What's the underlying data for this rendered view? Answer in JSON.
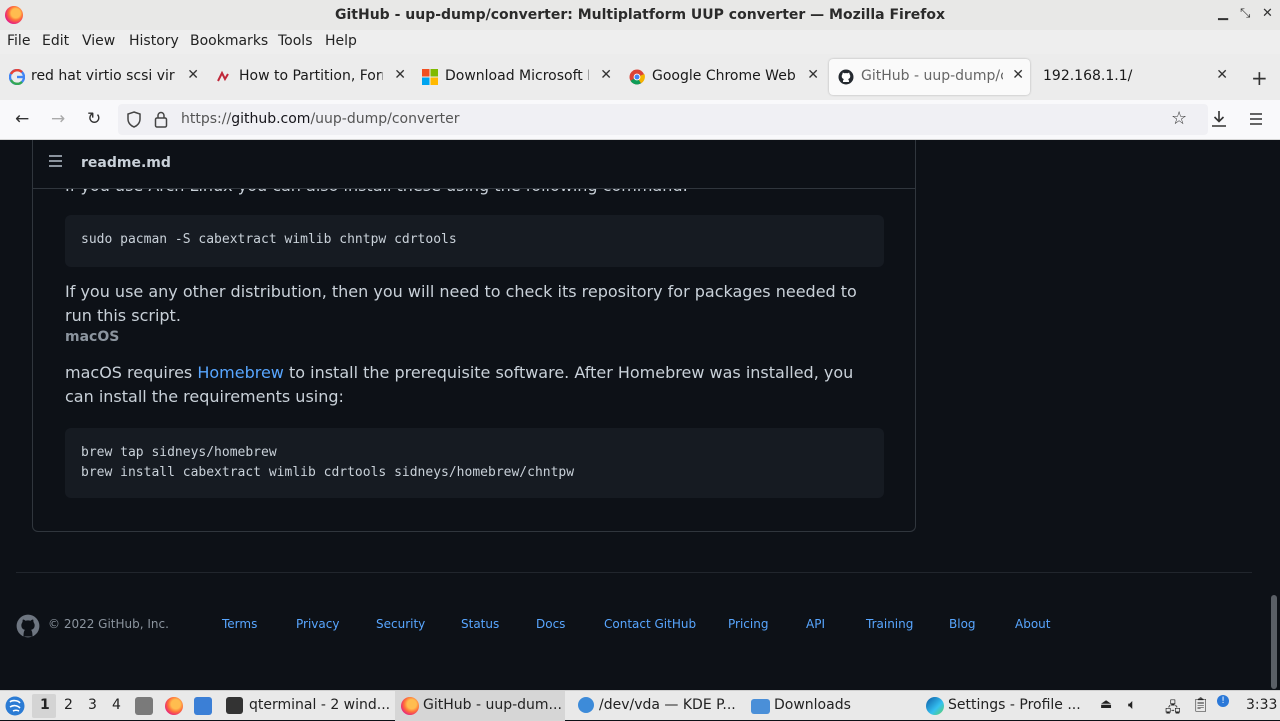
{
  "window": {
    "title": "GitHub - uup-dump/converter: Multiplatform UUP converter — Mozilla Firefox"
  },
  "menu": [
    "File",
    "Edit",
    "View",
    "History",
    "Bookmarks",
    "Tools",
    "Help"
  ],
  "tabs": [
    {
      "label": "red hat virtio scsi virtu",
      "icon": "google-icon"
    },
    {
      "label": "How to Partition, Form",
      "icon": "site-icon"
    },
    {
      "label": "Download Microsoft Ec",
      "icon": "microsoft-icon"
    },
    {
      "label": "Google Chrome Web B",
      "icon": "chrome-icon"
    },
    {
      "label": "GitHub - uup-dump/co",
      "icon": "github-icon"
    },
    {
      "label": "192.168.1.1/",
      "icon": ""
    }
  ],
  "url": {
    "prefix": "https://",
    "host": "github.com",
    "path": "/uup-dump/converter"
  },
  "readme": {
    "header": "readme.md",
    "partial_line": "If you use Arch Linux you can also install these using the following command:",
    "arch_cmd": "sudo pacman -S cabextract wimlib chntpw cdrtools",
    "other_distro": "If you use any other distribution, then you will need to check its repository for packages needed to run this script.",
    "macos_heading": "macOS",
    "macos_pre": "macOS requires ",
    "homebrew_link": "Homebrew",
    "macos_post": " to install the prerequisite software. After Homebrew was installed, you can install the requirements using:",
    "brew_cmd_1": "brew tap sidneys/homebrew",
    "brew_cmd_2": "brew install cabextract wimlib cdrtools sidneys/homebrew/chntpw"
  },
  "footer": {
    "copyright": "© 2022 GitHub, Inc.",
    "links": [
      "Terms",
      "Privacy",
      "Security",
      "Status",
      "Docs",
      "Contact GitHub",
      "Pricing",
      "API",
      "Training",
      "Blog",
      "About"
    ]
  },
  "taskbar": {
    "desktops": [
      "1",
      "2",
      "3",
      "4"
    ],
    "tasks": [
      "qterminal - 2 wind...",
      "GitHub - uup-dum...",
      "/dev/vda — KDE P...",
      "Downloads",
      "Settings - Profile ..."
    ],
    "clock": "3:33"
  },
  "colors": {
    "link": "#58a6ff",
    "bg": "#0d1117",
    "code_bg": "#161b22"
  }
}
